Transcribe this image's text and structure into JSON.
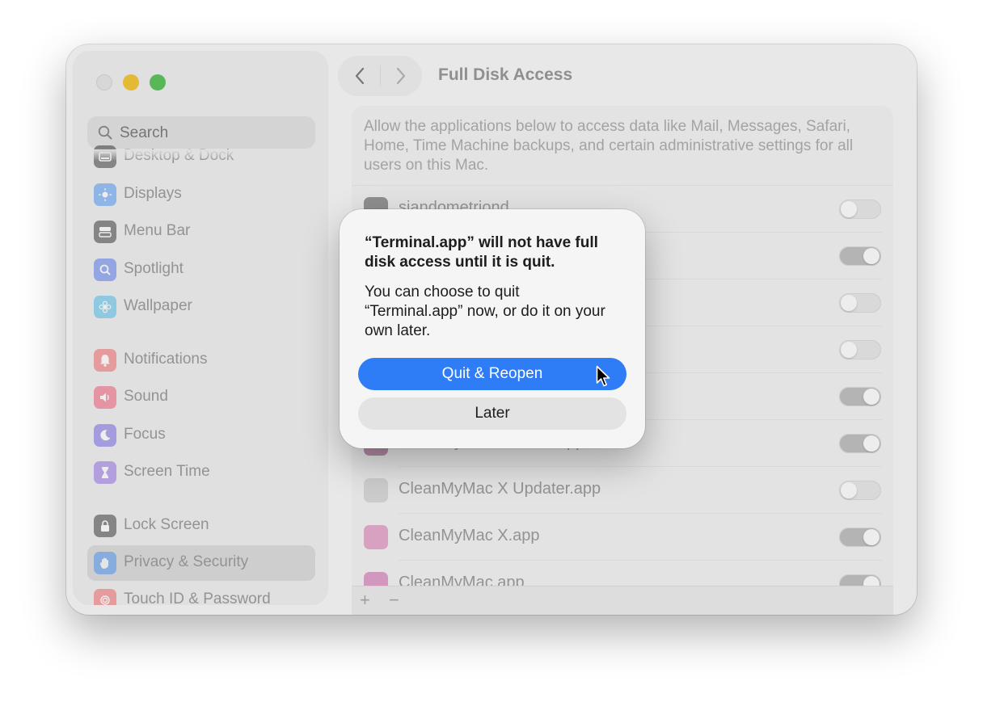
{
  "window": {
    "title": "Full Disk Access"
  },
  "sidebar": {
    "search_placeholder": "Search",
    "items": [
      {
        "label": "Desktop & Dock",
        "icon": "dock-icon",
        "color": "#2b2b2b"
      },
      {
        "label": "Displays",
        "icon": "sun-icon",
        "color": "#3d8ef0"
      },
      {
        "label": "Menu Bar",
        "icon": "menubar-icon",
        "color": "#2b2b2b"
      },
      {
        "label": "Spotlight",
        "icon": "magnifier-icon",
        "color": "#4b6ee8"
      },
      {
        "label": "Wallpaper",
        "icon": "flower-icon",
        "color": "#3fb3e6"
      },
      {
        "label": "Notifications",
        "icon": "bell-icon",
        "color": "#ee5a5a"
      },
      {
        "label": "Sound",
        "icon": "speaker-icon",
        "color": "#ee4a6a"
      },
      {
        "label": "Focus",
        "icon": "moon-icon",
        "color": "#6a5be2"
      },
      {
        "label": "Screen Time",
        "icon": "hourglass-icon",
        "color": "#8b5fe0"
      },
      {
        "label": "Lock Screen",
        "icon": "lock-icon",
        "color": "#2b2b2b"
      },
      {
        "label": "Privacy & Security",
        "icon": "hand-icon",
        "color": "#3d8ef0"
      },
      {
        "label": "Touch ID & Password",
        "icon": "fingerprint-icon",
        "color": "#ee5a5a"
      }
    ]
  },
  "content": {
    "description": "Allow the applications below to access data like Mail, Messages, Safari, Home, Time Machine backups, and certain administrative settings for all users on this Mac.",
    "apps": [
      {
        "name": "sjandometriond",
        "enabled": false
      },
      {
        "name": "",
        "enabled": true
      },
      {
        "name": "",
        "enabled": false
      },
      {
        "name": "",
        "enabled": false
      },
      {
        "name": "",
        "enabled": true
      },
      {
        "name": "CleanMyMac X Menu.app",
        "enabled": true
      },
      {
        "name": "CleanMyMac X Updater.app",
        "enabled": false
      },
      {
        "name": "CleanMyMac X.app",
        "enabled": true
      },
      {
        "name": "CleanMyMac.app",
        "enabled": true
      }
    ],
    "add_label": "+",
    "remove_label": "−"
  },
  "alert": {
    "title": "“Terminal.app” will not have full disk access until it is quit.",
    "message": "You can choose to quit “Terminal.app” now, or do it on your own later.",
    "primary_button": "Quit & Reopen",
    "secondary_button": "Later"
  },
  "colors": {
    "accent": "#2e7cf6",
    "traffic_close": "#dadada",
    "traffic_minimize": "#e8b823",
    "traffic_maximize": "#4cb64b"
  }
}
